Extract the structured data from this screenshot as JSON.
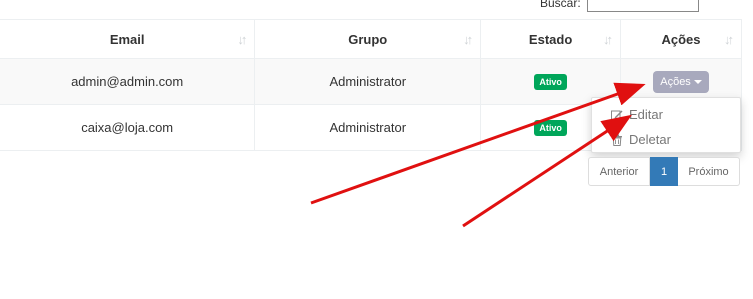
{
  "search": {
    "label": "Buscar:",
    "value": ""
  },
  "table": {
    "headers": {
      "email": "Email",
      "grupo": "Grupo",
      "estado": "Estado",
      "acoes": "Ações"
    },
    "rows": [
      {
        "email": "admin@admin.com",
        "grupo": "Administrator",
        "estado": "Ativo"
      },
      {
        "email": "caixa@loja.com",
        "grupo": "Administrator",
        "estado": "Ativo"
      }
    ]
  },
  "actions": {
    "button_label": "Ações",
    "menu": [
      {
        "label": "Editar",
        "icon": "edit-icon"
      },
      {
        "label": "Deletar",
        "icon": "trash-icon"
      }
    ]
  },
  "pagination": {
    "prev": "Anterior",
    "current": "1",
    "next": "Próximo"
  },
  "colors": {
    "badge": "#00a65a",
    "action_button": "#a8a9bd",
    "page_active": "#337ab7",
    "annotation_arrow": "#e01010"
  }
}
